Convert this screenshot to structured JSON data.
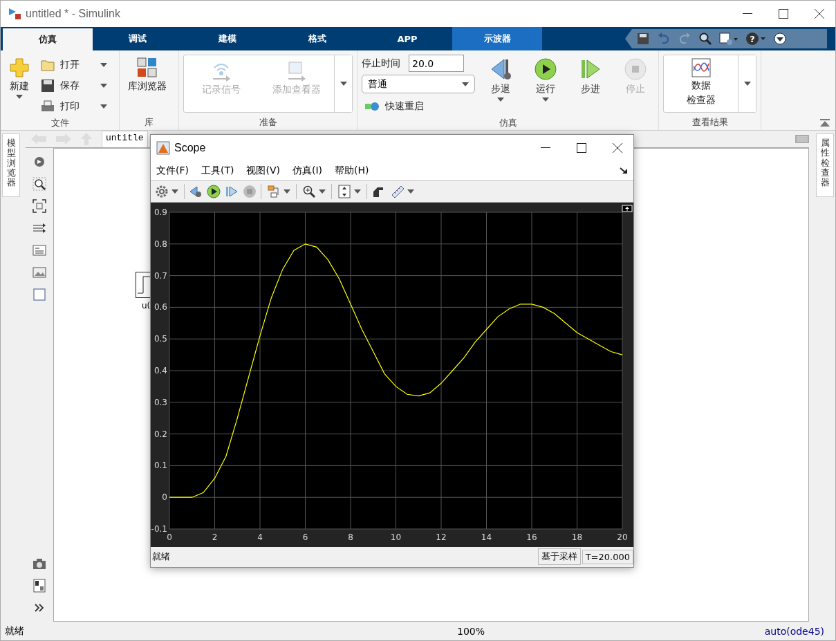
{
  "window": {
    "title": "untitled * - Simulink"
  },
  "ribbon_tabs": [
    {
      "label": "仿真",
      "selected": true,
      "contextual": false
    },
    {
      "label": "调试",
      "selected": false,
      "contextual": false
    },
    {
      "label": "建模",
      "selected": false,
      "contextual": false
    },
    {
      "label": "格式",
      "selected": false,
      "contextual": false
    },
    {
      "label": "APP",
      "selected": false,
      "contextual": false
    },
    {
      "label": "示波器",
      "selected": false,
      "contextual": true
    }
  ],
  "quick_access": {
    "help_glyph": "?"
  },
  "file_group": {
    "label": "文件",
    "new_button": "新建",
    "items": [
      "打开",
      "保存",
      "打印"
    ]
  },
  "library_group": {
    "label": "库",
    "button": "库浏览器"
  },
  "prepare_group": {
    "label": "准备",
    "buttons": [
      {
        "label": "记录信号",
        "disabled": true
      },
      {
        "label": "添加查看器",
        "disabled": true
      }
    ]
  },
  "simulation_group": {
    "label": "仿真",
    "stop_time_label": "停止时间",
    "stop_time": "20.0",
    "mode": "普通",
    "fast_restart": "快速重启",
    "buttons": [
      {
        "label": "步退",
        "kind": "back",
        "disabled": false,
        "menu": true
      },
      {
        "label": "运行",
        "kind": "run",
        "disabled": false,
        "menu": true
      },
      {
        "label": "步进",
        "kind": "forward",
        "disabled": false,
        "menu": false
      },
      {
        "label": "停止",
        "kind": "stop",
        "disabled": true,
        "menu": false
      }
    ]
  },
  "review_group": {
    "label": "查看结果",
    "button_lines": [
      "数据",
      "检查器"
    ]
  },
  "side_tabs": {
    "left": "模型浏览器",
    "right": "属性检查器"
  },
  "breadcrumb": "untitle",
  "canvas": {
    "block_label": "u("
  },
  "scope": {
    "title": "Scope",
    "menu": [
      "文件(F)",
      "工具(T)",
      "视图(V)",
      "仿真(I)",
      "帮助(H)"
    ],
    "chart_data": {
      "type": "line",
      "grid": true,
      "xlim": [
        0,
        20
      ],
      "ylim": [
        -0.1,
        0.9
      ],
      "xticks": [
        0,
        2,
        4,
        6,
        8,
        10,
        12,
        14,
        16,
        18,
        20
      ],
      "yticks": [
        -0.1,
        0,
        0.1,
        0.2,
        0.3,
        0.4,
        0.5,
        0.6,
        0.7,
        0.8,
        0.9
      ],
      "x": [
        0,
        1,
        1.5,
        2,
        2.5,
        3,
        3.5,
        4,
        4.5,
        5,
        5.5,
        6,
        6.5,
        7,
        7.5,
        8,
        8.5,
        9,
        9.5,
        10,
        10.5,
        11,
        11.5,
        12,
        12.5,
        13,
        13.5,
        14,
        14.5,
        15,
        15.5,
        16,
        16.5,
        17,
        17.5,
        18,
        18.5,
        19,
        19.5,
        20
      ],
      "series": [
        {
          "color": "#ffff00",
          "values": [
            0,
            0,
            0.015,
            0.06,
            0.13,
            0.25,
            0.38,
            0.51,
            0.63,
            0.72,
            0.78,
            0.8,
            0.79,
            0.75,
            0.69,
            0.61,
            0.53,
            0.46,
            0.39,
            0.35,
            0.325,
            0.32,
            0.33,
            0.36,
            0.4,
            0.44,
            0.49,
            0.53,
            0.57,
            0.595,
            0.61,
            0.61,
            0.6,
            0.58,
            0.55,
            0.52,
            0.5,
            0.48,
            0.46,
            0.45
          ]
        }
      ]
    },
    "status": "就绪",
    "status_fields": [
      "基于采样",
      "T=20.000"
    ]
  },
  "status_bar": {
    "left": "就绪",
    "zoom": "100%",
    "solver": "auto(ode45)"
  }
}
